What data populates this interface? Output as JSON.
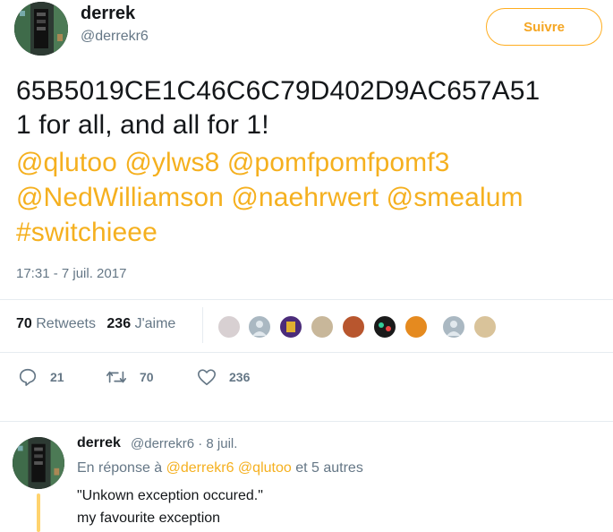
{
  "author": {
    "name": "derrek",
    "handle": "@derrekr6"
  },
  "follow_button": {
    "label": "Suivre"
  },
  "tweet": {
    "line1": "65B5019CE1C46C6C79D402D9AC657A51",
    "line2": "1 for all, and all for 1!",
    "mentions_line1": [
      "@qlutoo",
      "@ylws8",
      "@pomfpomfpomf3"
    ],
    "mentions_line2": [
      "@NedWilliamson",
      "@naehrwert",
      "@smealum"
    ],
    "hashtag": "#switchieee",
    "timestamp": "17:31 - 7 juil. 2017"
  },
  "stats": {
    "retweets_count": "70",
    "retweets_label": "Retweets",
    "likes_count": "236",
    "likes_label": "J'aime"
  },
  "actions": {
    "reply_count": "21",
    "retweet_count": "70",
    "like_count": "236"
  },
  "reply": {
    "name": "derrek",
    "handle_date": "@derrekr6 · 8 juil.",
    "in_reply_prefix": "En réponse à",
    "in_reply_user1": "@derrekr6",
    "in_reply_user2": "@qlutoo",
    "in_reply_suffix": "et 5 autres",
    "text_line1": "\"Unkown exception occured.\"",
    "text_line2": "my favourite exception"
  },
  "colors": {
    "accent": "#f5b01f",
    "secondary": "#657786",
    "border": "#e6ecf0"
  }
}
